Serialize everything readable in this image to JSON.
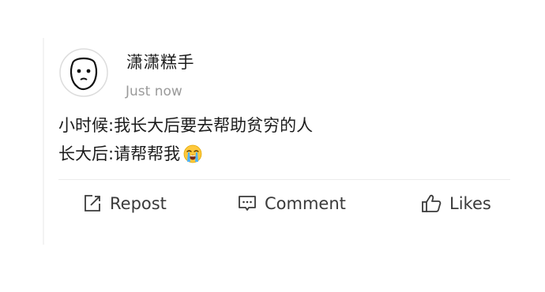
{
  "post": {
    "username": "潇潇糕手",
    "timestamp": "Just now",
    "lines": [
      "小时候:我长大后要去帮助贫穷的人",
      "长大后:请帮帮我"
    ],
    "emoji_icon": "loudly-crying-face-icon"
  },
  "actions": {
    "repost_label": "Repost",
    "comment_label": "Comment",
    "likes_label": "Likes"
  },
  "colors": {
    "text": "#1c1c1c",
    "muted": "#9a9a9a",
    "action": "#3a3a3a",
    "divider": "#ececec"
  }
}
